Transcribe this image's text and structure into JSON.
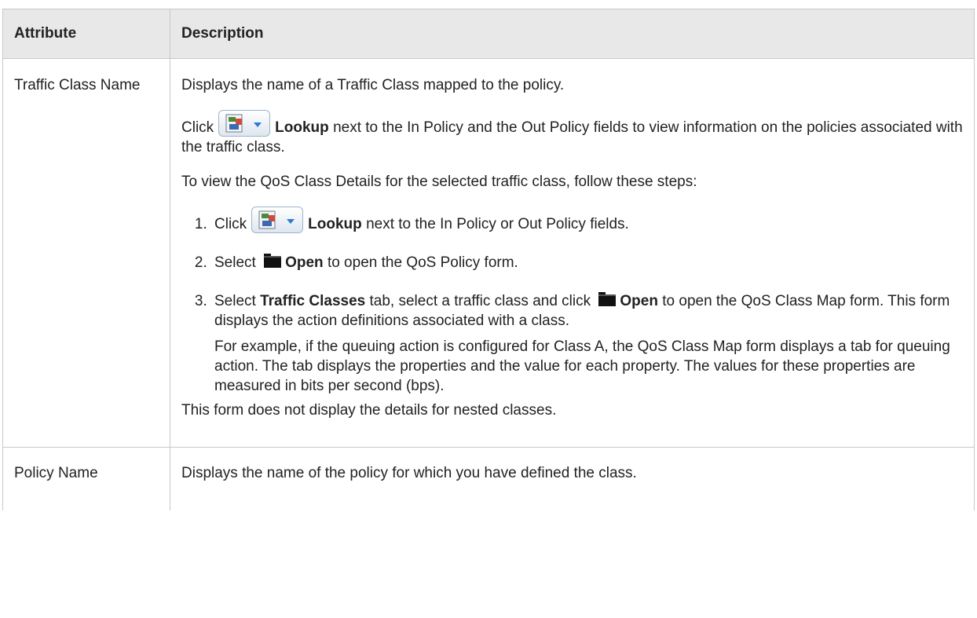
{
  "table": {
    "headers": {
      "attribute": "Attribute",
      "description": "Description"
    },
    "rows": [
      {
        "attribute": "Traffic Class Name",
        "desc_line1": "Displays the name of a Traffic Class mapped to the policy.",
        "lookup_para": {
          "pre": "Click",
          "bold": "Lookup",
          "post": "next to the In Policy and the Out Policy fields to view information on the policies associated with the traffic class."
        },
        "steps_intro": "To view the QoS Class Details for the selected traffic class, follow these steps:",
        "steps": [
          {
            "pre": "Click",
            "bold": "Lookup",
            "post": "next to the In Policy or Out Policy fields."
          },
          {
            "pre": "Select",
            "bold": "Open",
            "post": "to open the QoS Policy form."
          },
          {
            "pre": "Select",
            "bold": "Traffic Classes",
            "mid": "tab, select a traffic class and click",
            "bold2": "Open",
            "post": "to open the QoS Class Map form. This form displays the action definitions associated with a class.",
            "sub": "For example, if the queuing action is configured for Class A, the QoS Class Map form displays a tab for queuing action. The tab displays the properties and the value for each property. The values for these properties are measured in bits per second (bps)."
          }
        ],
        "footer": "This form does not display the details for nested classes."
      },
      {
        "attribute": "Policy Name",
        "desc_line1": "Displays the name of the policy for which you have defined the class."
      }
    ]
  },
  "icons": {
    "lookup": "lookup-icon",
    "open": "folder-open-icon"
  }
}
